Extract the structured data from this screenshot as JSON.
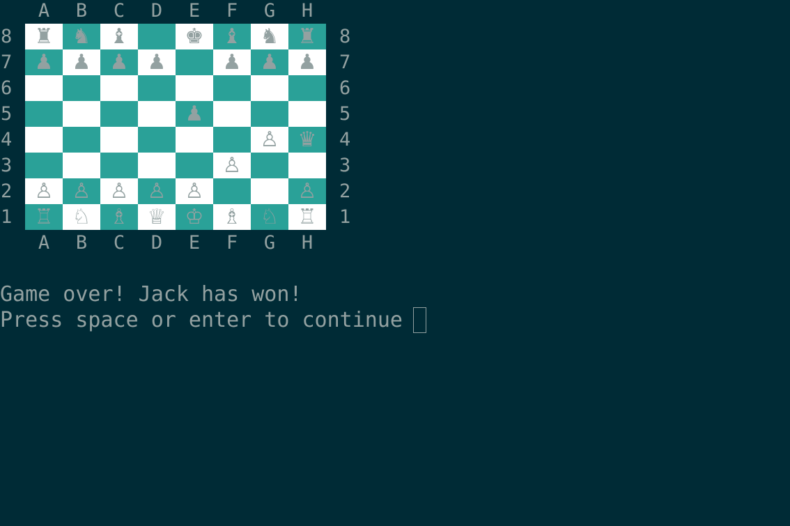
{
  "files": [
    "A",
    "B",
    "C",
    "D",
    "E",
    "F",
    "G",
    "H"
  ],
  "ranks": [
    "8",
    "7",
    "6",
    "5",
    "4",
    "3",
    "2",
    "1"
  ],
  "colors": {
    "background": "#002b36",
    "text": "#93a1a1",
    "light_square": "#ffffff",
    "dark_square": "#2aa198",
    "piece_ink": "#002b36"
  },
  "board": [
    [
      "♜",
      "♞",
      "♝",
      "",
      "♚",
      "♝",
      "♞",
      "♜"
    ],
    [
      "♟",
      "♟",
      "♟",
      "♟",
      "",
      "♟",
      "♟",
      "♟"
    ],
    [
      "",
      "",
      "",
      "",
      "",
      "",
      "",
      ""
    ],
    [
      "",
      "",
      "",
      "",
      "♟",
      "",
      "",
      ""
    ],
    [
      "",
      "",
      "",
      "",
      "",
      "",
      "♙",
      "♛"
    ],
    [
      "",
      "",
      "",
      "",
      "",
      "♙",
      "",
      ""
    ],
    [
      "♙",
      "♙",
      "♙",
      "♙",
      "♙",
      "",
      "",
      "♙"
    ],
    [
      "♖",
      "♘",
      "♗",
      "♕",
      "♔",
      "♗",
      "♘",
      "♖"
    ]
  ],
  "messages": {
    "line1": "Game over! Jack has won!",
    "line2": "Press space or enter to continue"
  }
}
